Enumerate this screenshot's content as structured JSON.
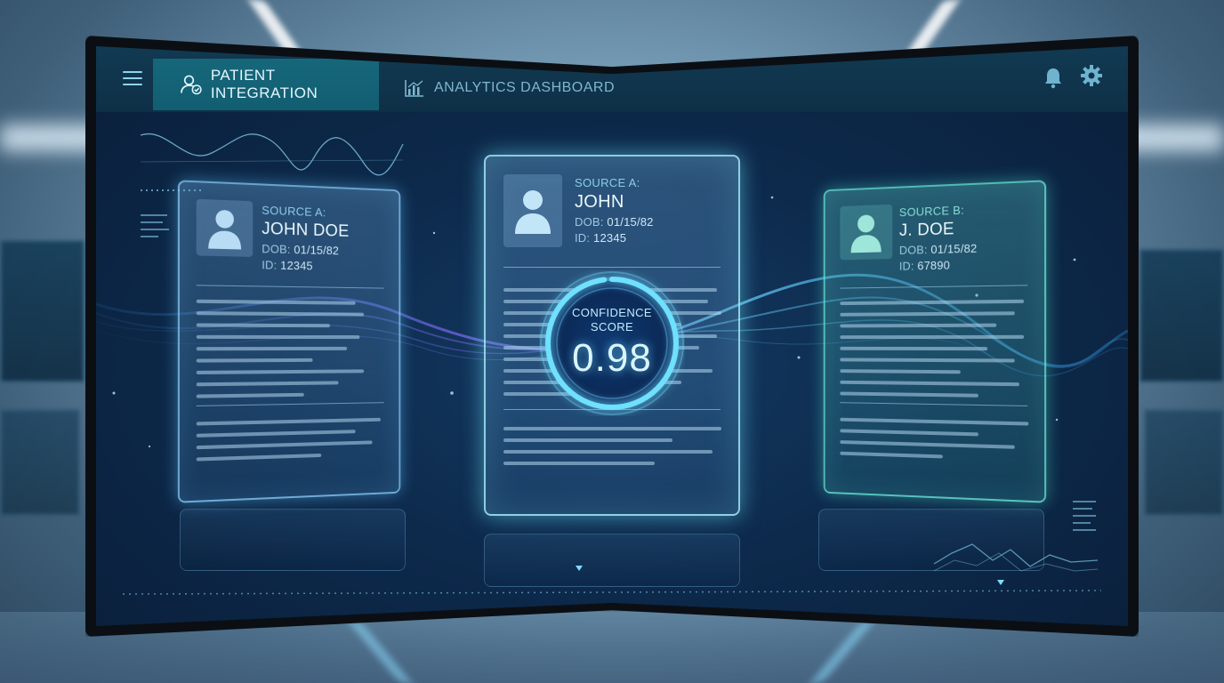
{
  "topbar": {
    "tabs": [
      {
        "label": "PATIENT INTEGRATION",
        "icon": "user-check-icon",
        "active": true
      },
      {
        "label": "ANALYTICS DASHBOARD",
        "icon": "bar-chart-icon",
        "active": false
      }
    ],
    "icons": [
      "menu-icon",
      "bell-icon",
      "gear-icon"
    ]
  },
  "records": {
    "left": {
      "source": "SOURCE A:",
      "name": "JOHN DOE",
      "dob_label": "DOB:",
      "dob": "01/15/82",
      "id_label": "ID:",
      "id": "12345"
    },
    "center": {
      "source": "SOURCE A:",
      "name": "JOHN",
      "dob_label": "DOB:",
      "dob": "01/15/82",
      "id_label": "ID:",
      "id": "12345"
    },
    "right": {
      "source": "SOURCE B:",
      "name": "J. DOE",
      "dob_label": "DOB:",
      "dob": "01/15/82",
      "id_label": "ID:",
      "id": "67890"
    }
  },
  "confidence": {
    "label_line1": "CONFIDENCE",
    "label_line2": "SCORE",
    "value": "0.98",
    "fraction": 0.98
  },
  "colors": {
    "accent": "#6fe0ff",
    "active_tab": "#14667a",
    "source_b": "#6fe6d4",
    "screen_bg": "#0d2a4c"
  }
}
